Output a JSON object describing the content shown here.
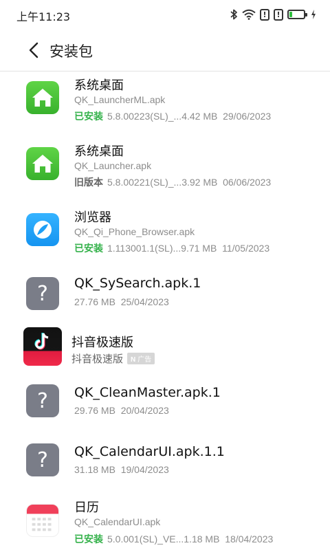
{
  "status_bar": {
    "time": "上午11:23",
    "icons": [
      "bluetooth-icon",
      "wifi-icon",
      "alert-icon",
      "alert-icon",
      "battery-icon",
      "charging-icon"
    ],
    "alert_glyph": "!",
    "battery_color": "#2fbf3f"
  },
  "header": {
    "title": "安装包"
  },
  "items": [
    {
      "name": "系统桌面",
      "file": "QK_LauncherML.apk",
      "status": "已安装",
      "version": "5.8.00223(SL)_...",
      "size": "4.42 MB",
      "date": "29/06/2023",
      "icon": "home-icon"
    },
    {
      "name": "系统桌面",
      "file": "QK_Launcher.apk",
      "status": "旧版本",
      "version": "5.8.00221(SL)_...",
      "size": "3.92 MB",
      "date": "06/06/2023",
      "icon": "home-icon"
    },
    {
      "name": "浏览器",
      "file": "QK_Qi_Phone_Browser.apk",
      "status": "已安装",
      "version": "1.113001.1(SL)...",
      "size": "9.71 MB",
      "date": "11/05/2023",
      "icon": "browser-icon"
    },
    {
      "name": "QK_SySearch.apk.1",
      "size": "27.76 MB",
      "date": "25/04/2023",
      "icon": "unknown-file-icon",
      "icon_glyph": "?"
    },
    {
      "name": "抖音极速版",
      "subtitle": "抖音极速版",
      "ad_label": "广告",
      "ad_mark": "N",
      "icon": "tiktok-icon"
    },
    {
      "name": "QK_CleanMaster.apk.1",
      "size": "29.76 MB",
      "date": "20/04/2023",
      "icon": "unknown-file-icon",
      "icon_glyph": "?"
    },
    {
      "name": "QK_CalendarUI.apk.1.1",
      "size": "31.18 MB",
      "date": "19/04/2023",
      "icon": "unknown-file-icon",
      "icon_glyph": "?"
    },
    {
      "name": "日历",
      "file": "QK_CalendarUI.apk",
      "status": "已安装",
      "version": "5.0.001(SL)_VE...",
      "size": "1.18 MB",
      "date": "18/04/2023",
      "icon": "calendar-icon"
    }
  ],
  "colors": {
    "installed": "#35b24b",
    "old_version": "#666666",
    "secondary_text": "#8c8c8c",
    "home_icon_bg": "#4bc63a",
    "browser_icon_bg": "#1e9ff5",
    "unknown_icon_bg": "#7a7d88",
    "calendar_accent": "#f0405a"
  }
}
